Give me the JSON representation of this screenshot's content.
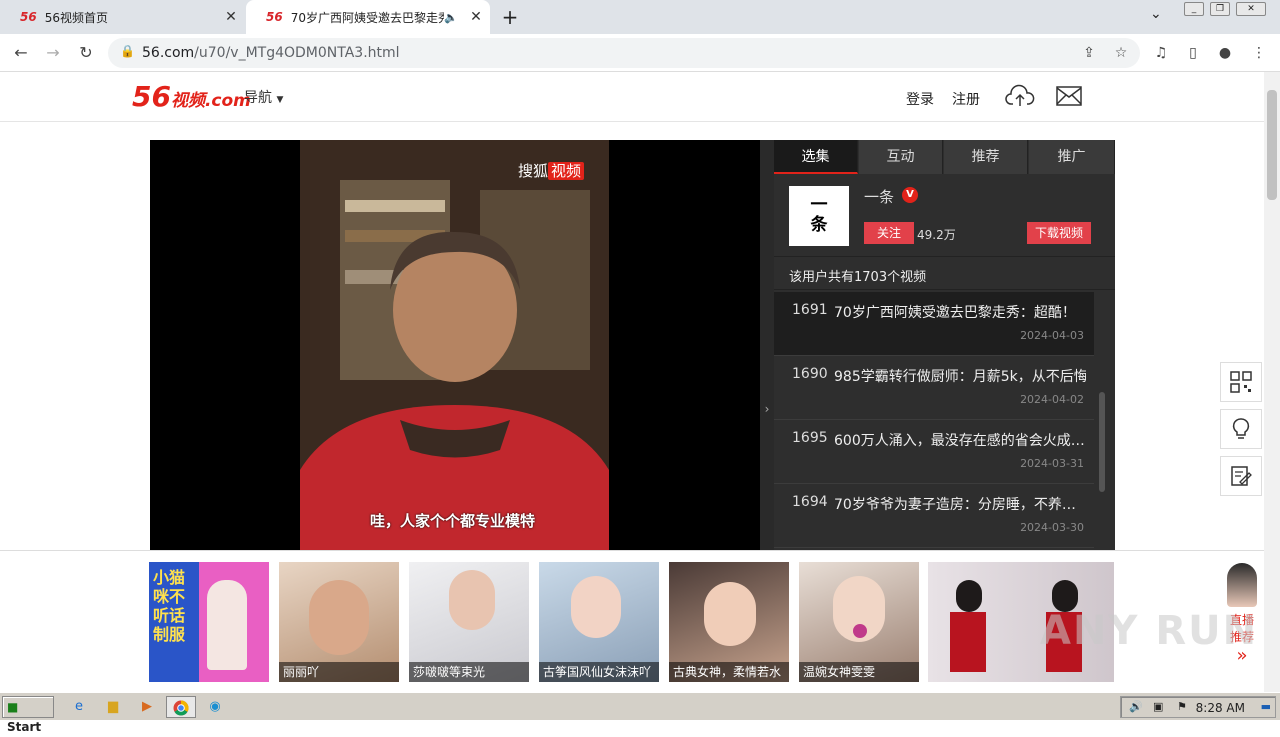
{
  "browser": {
    "tabs": [
      {
        "favicon": "56",
        "title": "56视频首页"
      },
      {
        "favicon": "56",
        "title": "70岁广西阿姨受邀去巴黎走秀"
      }
    ],
    "url_host": "56.com",
    "url_path": "/u70/v_MTg4ODM0NTA3.html"
  },
  "site": {
    "logo_text": "56",
    "logo_sub": "视频",
    "logo_domain": ".com",
    "nav_label": "导航",
    "login": "登录",
    "register": "注册"
  },
  "player": {
    "watermark": "搜狐",
    "watermark_highlight": "视频",
    "subtitle": "哇，人家个个都专业模特"
  },
  "sidebar": {
    "tabs": [
      "选集",
      "互动",
      "推荐",
      "推广"
    ],
    "uploader": {
      "avatar_text": "一条",
      "name": "一条",
      "follow": "关注",
      "fans": "49.2万",
      "download": "下载视频"
    },
    "video_count": "该用户共有1703个视频",
    "episodes": [
      {
        "num": "1691",
        "title": "70岁广西阿姨受邀去巴黎走秀：超酷！",
        "date": "2024-04-03"
      },
      {
        "num": "1690",
        "title": "985学霸转行做厨师：月薪5k，从不后悔",
        "date": "2024-04-02"
      },
      {
        "num": "1695",
        "title": "600万人涌入，最没存在感的省会火成…",
        "date": "2024-03-31"
      },
      {
        "num": "1694",
        "title": "70岁爷爷为妻子造房：分房睡，不养…",
        "date": "2024-03-30"
      }
    ]
  },
  "ads": [
    {
      "caption": "",
      "overlay": "小猫咪不听话 制服"
    },
    {
      "caption": "丽丽吖"
    },
    {
      "caption": "莎啵啵等束光"
    },
    {
      "caption": "古筝国风仙女沫沫吖"
    },
    {
      "caption": "古典女神，柔情若水"
    },
    {
      "caption": "温婉女神雯雯"
    },
    {
      "caption": ""
    }
  ],
  "live_rec": {
    "line1": "直播",
    "line2": "推荐",
    "arrow": "»"
  },
  "watermark_brand": "ANY RUN",
  "taskbar": {
    "start": "Start",
    "clock": "8:28 AM"
  },
  "colors": {
    "brand_red": "#e2231a",
    "sidebar_bg": "#2e2e2e"
  }
}
